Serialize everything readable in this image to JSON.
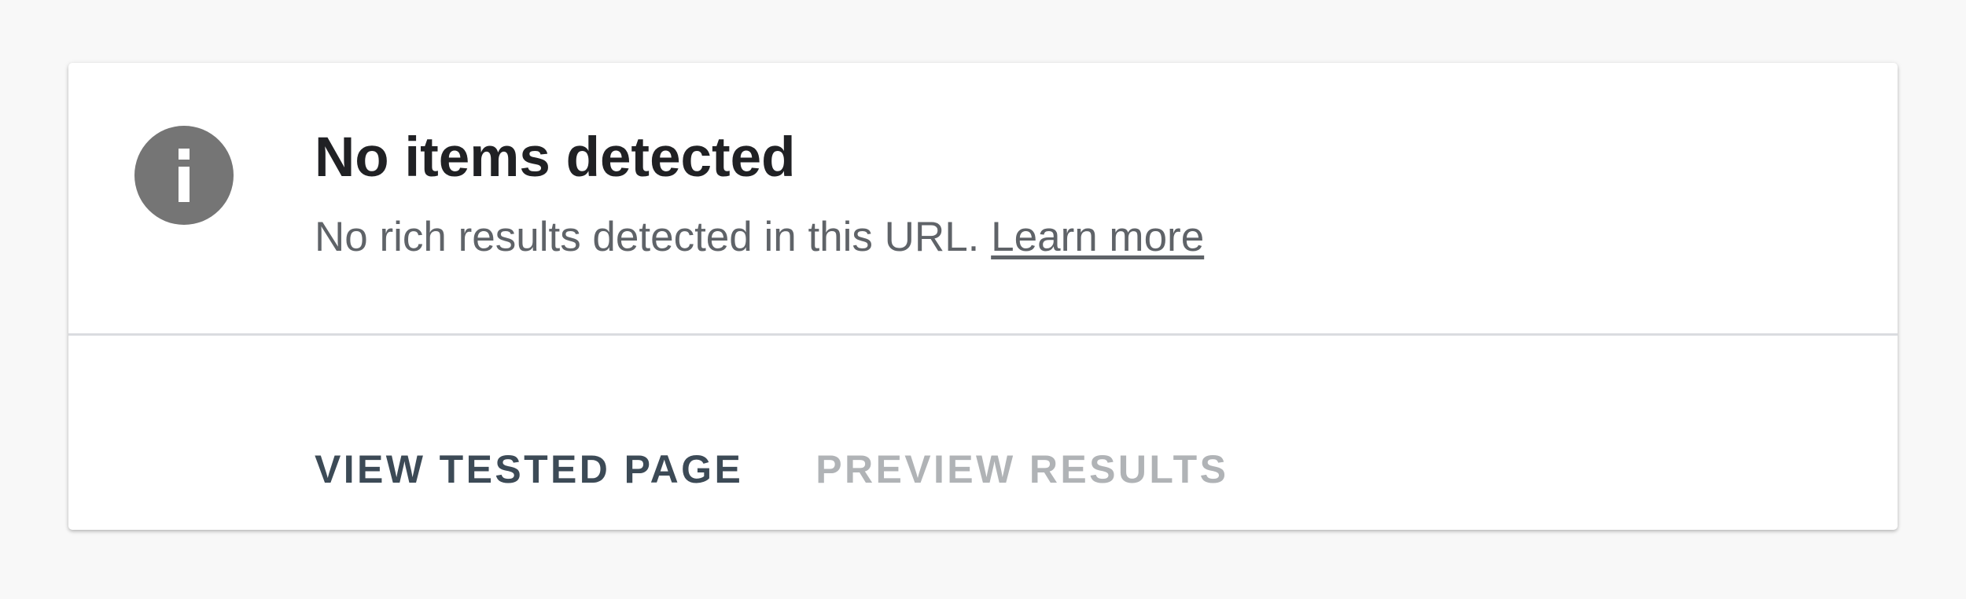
{
  "card": {
    "icon": "info-icon",
    "title": "No items detected",
    "description": "No rich results detected in this URL.",
    "learn_more_label": "Learn more"
  },
  "actions": {
    "view_tested_page_label": "VIEW TESTED PAGE",
    "preview_results_label": "PREVIEW RESULTS",
    "preview_results_enabled": false
  },
  "colors": {
    "icon_circle": "#757575",
    "title_text": "#202124",
    "body_text": "#5f6368",
    "primary_action": "#3c4a56",
    "disabled_action": "#b0b3b6",
    "divider": "#dadce0",
    "page_background": "#f8f8f8"
  }
}
